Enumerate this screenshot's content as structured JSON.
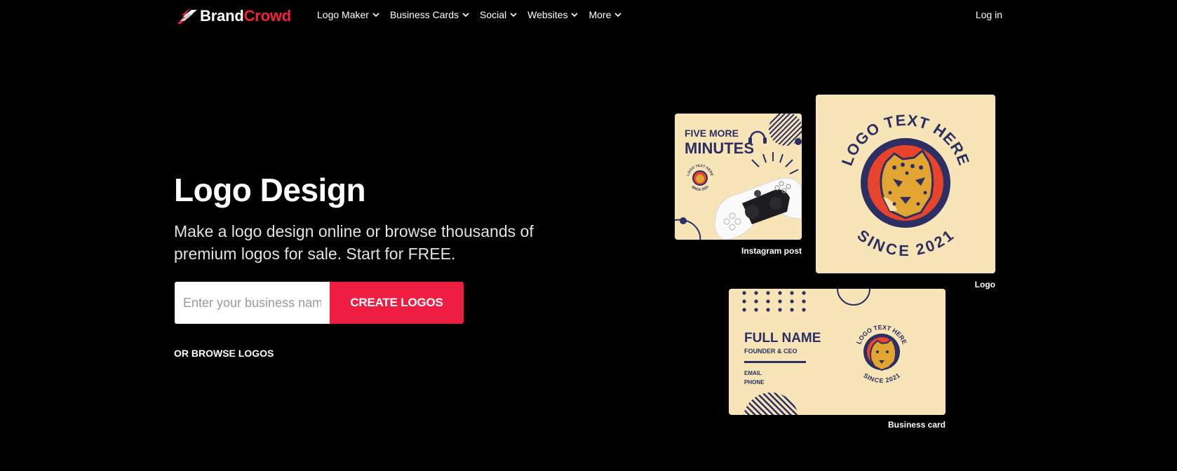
{
  "brand": {
    "part1": "Brand",
    "part2": "Crowd"
  },
  "nav": {
    "items": [
      {
        "label": "Logo Maker"
      },
      {
        "label": "Business Cards"
      },
      {
        "label": "Social"
      },
      {
        "label": "Websites"
      },
      {
        "label": "More"
      }
    ],
    "login": "Log in"
  },
  "hero": {
    "title": "Logo Design",
    "subtitle": "Make a logo design online or browse thousands of premium logos for sale. Start for FREE.",
    "input_placeholder": "Enter your business name",
    "cta": "CREATE LOGOS",
    "browse": "OR BROWSE LOGOS"
  },
  "cards": {
    "instagram": {
      "caption": "Instagram post",
      "line1": "FIVE MORE",
      "line2": "MINUTES",
      "mini_top": "LOGO TEXT HERE",
      "mini_bottom": "SINCE 2021"
    },
    "logo": {
      "caption": "Logo",
      "top_text": "LOGO TEXT HERE",
      "bottom_text": "SINCE 2021"
    },
    "business": {
      "caption": "Business card",
      "name": "FULL NAME",
      "role": "FOUNDER & CEO",
      "email": "EMAIL",
      "phone": "PHONE",
      "top_text": "LOGO TEXT HERE",
      "bottom_text": "SINCE 2021"
    }
  },
  "colors": {
    "accent": "#f01d43",
    "cream": "#f7e4b7",
    "navy": "#2b2f63",
    "badge_red": "#e8442b",
    "leopard": "#e3a531"
  },
  "icons": [
    "brandcrowd-logo-icon",
    "chevron-down-icon",
    "leopard-icon",
    "gamepad-icon",
    "headphones-icon"
  ]
}
